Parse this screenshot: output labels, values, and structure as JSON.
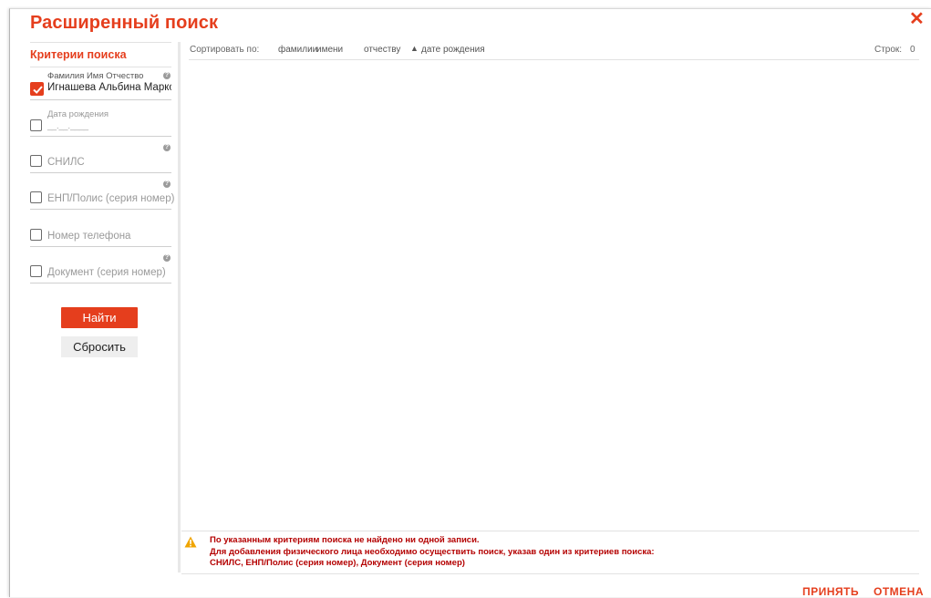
{
  "dialog": {
    "title": "Расширенный поиск",
    "close_icon": "close-icon"
  },
  "criteria": {
    "header": "Критерии поиска",
    "fields": [
      {
        "label": "Фамилия Имя Отчество",
        "value": "Игнашева Альбина Марко",
        "checked": true,
        "help": true
      },
      {
        "label": "Дата рождения",
        "placeholder": "__.__.____",
        "checked": false,
        "help": false
      },
      {
        "placeholder": "СНИЛС",
        "checked": false,
        "help": true
      },
      {
        "placeholder": "ЕНП/Полис (серия номер)",
        "checked": false,
        "help": true
      },
      {
        "placeholder": "Номер телефона",
        "checked": false,
        "help": false
      },
      {
        "placeholder": "Документ (серия номер)",
        "checked": false,
        "help": true
      }
    ],
    "find_label": "Найти",
    "reset_label": "Сбросить"
  },
  "results": {
    "sort_label": "Сортировать по:",
    "sort_options": [
      "фамилии",
      "имени",
      "отчеству",
      "дате рождения"
    ],
    "active_sort": "дате рождения",
    "rows_label": "Строк:",
    "rows_count": "0",
    "message_lines": [
      "По указанным критериям поиска не найдено ни одной записи.",
      "Для добавления физического лица необходимо осуществить поиск, указав один из критериев поиска:",
      "СНИЛС, ЕНП/Полис (серия номер), Документ (серия номер)"
    ]
  },
  "footer": {
    "accept_label": "ПРИНЯТЬ",
    "cancel_label": "ОТМЕНА"
  },
  "colors": {
    "accent": "#e53e1d",
    "error_text": "#b40000",
    "warning": "#f0a500"
  }
}
